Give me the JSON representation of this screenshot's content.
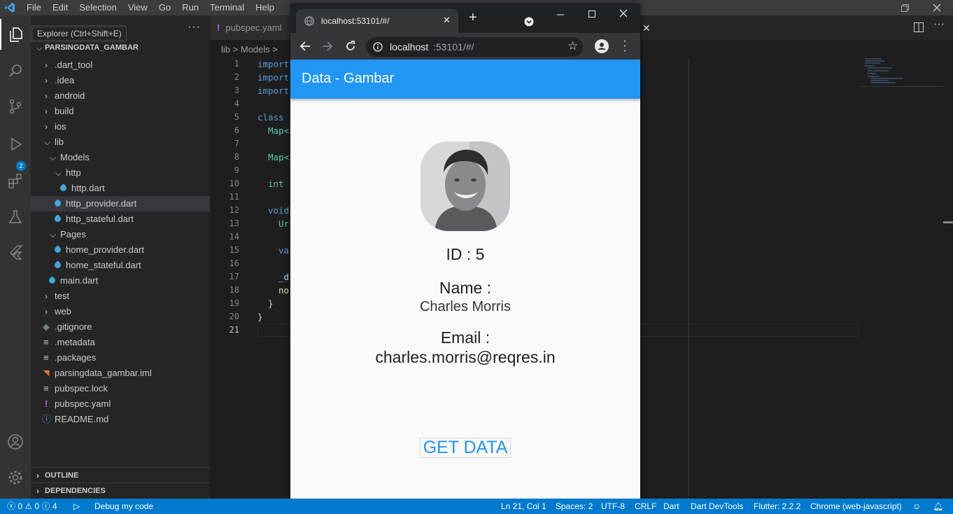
{
  "menubar": {
    "items": [
      "File",
      "Edit",
      "Selection",
      "View",
      "Go",
      "Run",
      "Terminal",
      "Help"
    ]
  },
  "activity": {
    "debug_badge": "2"
  },
  "sidebar": {
    "tooltip": "Explorer (Ctrl+Shift+E)",
    "more": "···",
    "root": "PARSINGDATA_GAMBAR",
    "items": [
      {
        "label": ".dart_tool"
      },
      {
        "label": ".idea"
      },
      {
        "label": "android"
      },
      {
        "label": "build"
      },
      {
        "label": "ios"
      },
      {
        "label": "lib"
      },
      {
        "label": "Models"
      },
      {
        "label": "http"
      },
      {
        "label": "http.dart"
      },
      {
        "label": "http_provider.dart"
      },
      {
        "label": "http_stateful.dart"
      },
      {
        "label": "Pages"
      },
      {
        "label": "home_provider.dart"
      },
      {
        "label": "home_stateful.dart"
      },
      {
        "label": "main.dart"
      },
      {
        "label": "test"
      },
      {
        "label": "web"
      },
      {
        "label": ".gitignore"
      },
      {
        "label": ".metadata"
      },
      {
        "label": ".packages"
      },
      {
        "label": "parsingdata_gambar.iml"
      },
      {
        "label": "pubspec.lock"
      },
      {
        "label": "pubspec.yaml"
      },
      {
        "label": "README.md"
      }
    ],
    "outline": "OUTLINE",
    "dependencies": "DEPENDENCIES"
  },
  "editor": {
    "tab": "pubspec.yaml",
    "breadcrumb_lib": "lib",
    "breadcrumb_sep": ">",
    "breadcrumb_models": "Models",
    "lines": [
      "1",
      "2",
      "3",
      "4",
      "5",
      "6",
      "7",
      "8",
      "9",
      "10",
      "11",
      "12",
      "13",
      "14",
      "15",
      "16",
      "17",
      "18",
      "19",
      "20",
      "21"
    ],
    "code": {
      "l1": "import",
      "l2": "import",
      "l3": "import",
      "l5": "class",
      "l6": "Map<",
      "l8": "Map<",
      "l10": "int",
      "l12": "void",
      "l13": "Ur",
      "l15": "va",
      "l17": "_d",
      "l18": "no",
      "l19": "}",
      "l20": "}"
    }
  },
  "browser": {
    "tab_title": "localhost:53101/#/",
    "url_host": "localhost",
    "url_rest": ":53101/#/",
    "app_title": "Data - Gambar",
    "id_text": "ID : 5",
    "name_label": "Name :",
    "name_value": "Charles Morris",
    "email_label": "Email :",
    "email_value": "charles.morris@reqres.in",
    "button": "GET DATA"
  },
  "statusbar": {
    "errors": "0",
    "warnings": "0",
    "infos": "4",
    "debug": "Debug my code",
    "position": "Ln 21, Col 1",
    "spaces": "Spaces: 2",
    "encoding": "UTF-8",
    "eol": "CRLF",
    "language": "Dart",
    "devtools": "Dart DevTools",
    "flutter": "Flutter: 2.2.2",
    "device": "Chrome (web-javascript)"
  },
  "colors": {
    "accent": "#007acc",
    "app_bar": "#2196f3",
    "button_text": "#2196f3"
  }
}
